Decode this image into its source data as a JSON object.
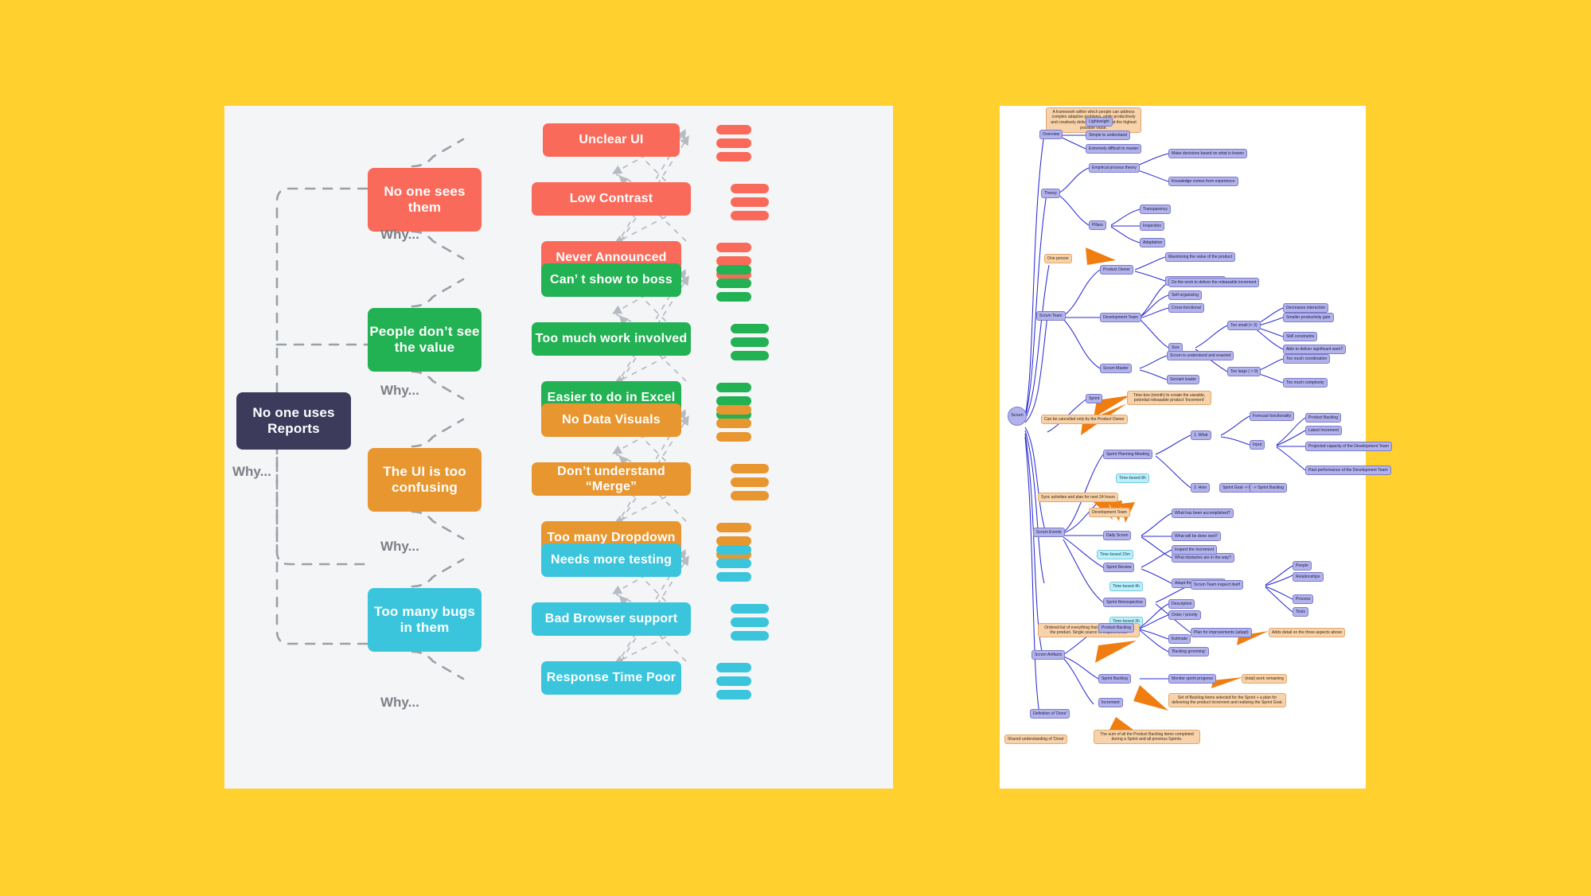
{
  "background_color": "#ffd02e",
  "left_board": {
    "name": "five-whys-board",
    "background_color": "#f4f5f7",
    "why_label": "Why...",
    "root": {
      "label": "No one uses Reports",
      "color": "#3c3b5c"
    },
    "branches": [
      {
        "id": "no-one-sees-them",
        "label": "No one sees them",
        "color": "#fa6a5a",
        "causes": [
          "Unclear UI",
          "Low Contrast",
          "Never Announced"
        ]
      },
      {
        "id": "people-dont-see-the-value",
        "label": "People don’t see the value",
        "color": "#22b153",
        "causes": [
          "Can’ t show to boss",
          "Too much work involved",
          "Easier to do in Excel"
        ]
      },
      {
        "id": "the-ui-is-too-confusing",
        "label": "The UI is too confusing",
        "color": "#e8962f",
        "causes": [
          "No Data Visuals",
          "Don’t understand “Merge”",
          "Too many Dropdown"
        ]
      },
      {
        "id": "too-many-bugs-in-them",
        "label": "Too many bugs in them",
        "color": "#3ac5dd",
        "causes": [
          "Needs more testing",
          "Bad Browser support",
          "Response Time Poor"
        ]
      }
    ]
  },
  "right_board": {
    "name": "scrum-mind-map",
    "background_color": "#ffffff",
    "root": "Scrum",
    "nodes": {
      "overview": "Overview",
      "overview_note": "A framework within which people can address complex adaptive problems, while productively and creatively delivering products at the highest possible value.",
      "lightweight": "Lightweight",
      "simple": "Simple to understand",
      "difficult": "Extremely difficult to master",
      "theory": "Theory",
      "empirical": "Empirical process theory",
      "decisions": "Make decisions based on what is known",
      "knowledge": "Knowledge comes from experience",
      "pillars": "Pillars",
      "transparency": "Transparency",
      "inspection": "Inspection",
      "adaptation": "Adaptation",
      "scrum_team": "Scrum Team",
      "one_person": "One person",
      "product_owner": "Product Owner",
      "maximizing": "Maximizing the value of the product",
      "manages_backlog": "Manages the Product Backlog",
      "development_team": "Development Team",
      "do_the_work": "Do the work to deliver the releasable increment",
      "self_organizing": "Self-organizing",
      "cross_functional": "Cross-functional",
      "size": "Size",
      "too_small": "Too small (< 3)",
      "decreases_interaction": "Decreases interaction",
      "smaller_productivity": "Smaller productivity gain",
      "skill_constraints": "Skill constraints",
      "able_to_deliver": "Able to deliver significant work?",
      "too_large": "Too large ( > 9)",
      "too_much_coordination": "Too much coordination",
      "too_much_complexity": "Too much complexity",
      "scrum_master": "Scrum Master",
      "understood_enacted": "Scrum is understood and enacted",
      "servant_leader": "Servant leader",
      "sprint": "Sprint",
      "sprint_note": "Time-box (month) to create the useable, potential releasable product 'Increment'",
      "cancelled_note": "Can be cancelled only by the Product Owner",
      "scrum_events": "Scrum Events",
      "sprint_planning": "Sprint Planning Meeting",
      "planning_time": "Time-boxed 8h",
      "what": "1. What",
      "forecast": "Forecast functionality",
      "input": "Input",
      "product_backlog_in": "Product Backlog",
      "latest_increment": "Latest Increment",
      "projected_capacity": "Projected capacity of the Development Team",
      "past_performance": "Past performance of the Development Team",
      "sprint_goal_inc": "Sprint Goal -> Increment",
      "how": "2. How",
      "sprint_backlog_arrow": "-> Sprint Backlog",
      "sync_note": "Sync activities and plan for next 24 hours",
      "dev_team_note": "Development Team",
      "daily_scrum": "Daily Scrum",
      "daily_time": "Time-boxed 15m",
      "accomplished": "What has been accomplished?",
      "done_next": "What will be done next?",
      "obstacles": "What obstacles are in the way?",
      "sprint_review": "Sprint Review",
      "review_time": "Time-boxed 4h",
      "inspect_increment": "Inspect the Increment",
      "adapt_backlog": "Adapt the Product Backlog",
      "sprint_retro": "Sprint Retrospective",
      "retro_time": "Time-boxed 3h",
      "team_inspect": "Scrum Team inspect itself",
      "people": "People",
      "relationships": "Relationships",
      "process": "Process",
      "tools": "Tools",
      "plan_improvements": "Plan for improvements (adapt)",
      "artifacts": "Scrum Artifacts",
      "backlog_note": "Ordered list of everything that might be needed in the product. Single source of requirements.",
      "product_backlog": "Product Backlog",
      "description": "Description",
      "order_priority": "Order / priority",
      "estimate": "Estimate",
      "grooming": "'Backlog grooming'",
      "grooming_note": "Adds detail on the three aspects above",
      "sprint_backlog": "Sprint Backlog",
      "monitor_progress": "Monitor sprint progress",
      "total_work": "(total) work remaining",
      "sprint_backlog_note": "Set of Backlog items selected for the Sprint + a plan for delivering the product increment and realizing the Sprint Goal.",
      "increment": "Increment",
      "increment_note": "The sum of all the Product Backlog items completed during a Sprint and all previous Sprints.",
      "definition_done": "Definition of 'Done'",
      "shared_understanding": "Shared understanding of 'Done'"
    }
  }
}
